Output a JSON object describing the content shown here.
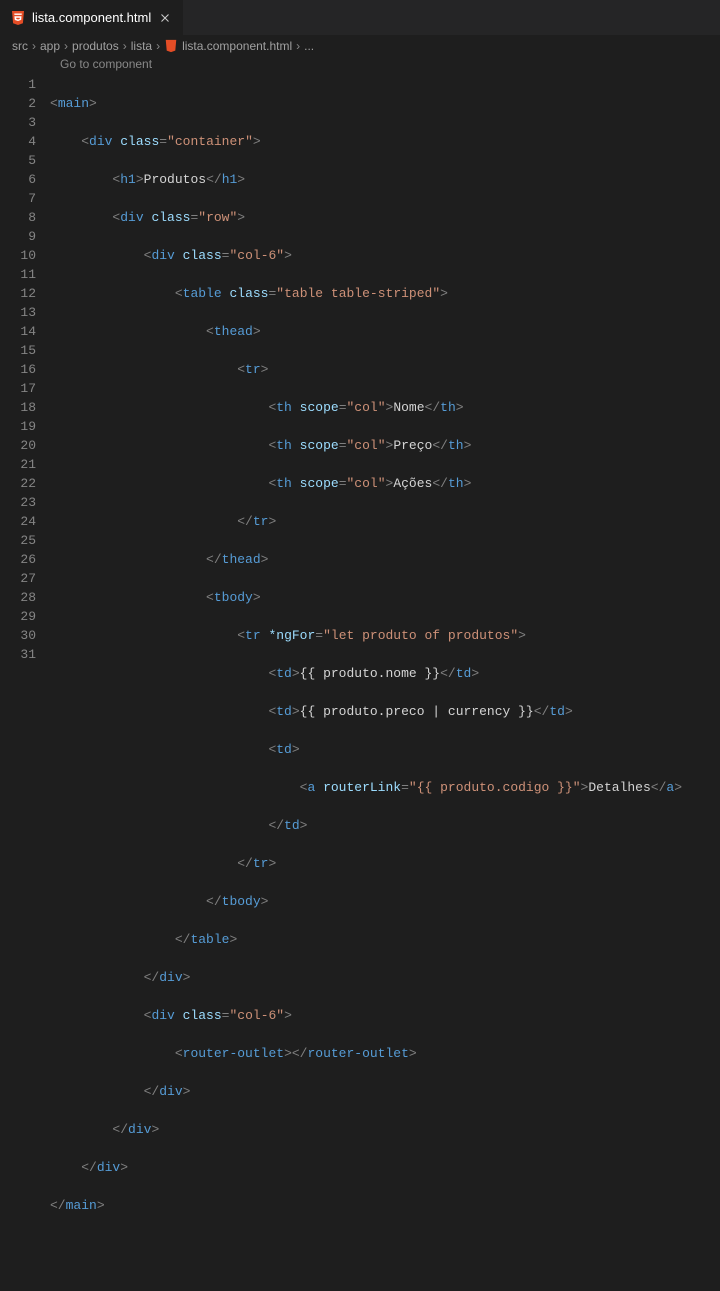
{
  "tab": {
    "title": "lista.component.html",
    "icon": "html5-icon"
  },
  "breadcrumbs": [
    "src",
    "app",
    "produtos",
    "lista",
    "lista.component.html",
    "..."
  ],
  "goToComponent": "Go to component",
  "lineNumbers": [
    "1",
    "2",
    "3",
    "4",
    "5",
    "6",
    "7",
    "8",
    "9",
    "10",
    "11",
    "12",
    "13",
    "14",
    "15",
    "16",
    "17",
    "18",
    "19",
    "20",
    "21",
    "22",
    "23",
    "24",
    "25",
    "26",
    "27",
    "28",
    "29",
    "30",
    "31"
  ],
  "code": {
    "line1": {
      "tag": "main"
    },
    "line2": {
      "tag": "div",
      "attr": "class",
      "val": "\"container\""
    },
    "line3": {
      "openTag": "h1",
      "text": "Produtos",
      "closeTag": "h1"
    },
    "line4": {
      "tag": "div",
      "attr": "class",
      "val": "\"row\""
    },
    "line5": {
      "tag": "div",
      "attr": "class",
      "val": "\"col-6\""
    },
    "line6": {
      "tag": "table",
      "attr": "class",
      "val": "\"table table-striped\""
    },
    "line7": {
      "tag": "thead"
    },
    "line8": {
      "tag": "tr"
    },
    "line9": {
      "tag": "th",
      "attr": "scope",
      "val": "\"col\"",
      "text": "Nome"
    },
    "line10": {
      "tag": "th",
      "attr": "scope",
      "val": "\"col\"",
      "text": "Preço"
    },
    "line11": {
      "tag": "th",
      "attr": "scope",
      "val": "\"col\"",
      "text": "Ações"
    },
    "line12": {
      "tag": "tr"
    },
    "line13": {
      "tag": "thead"
    },
    "line14": {
      "tag": "tbody"
    },
    "line15": {
      "tag": "tr",
      "attr": "*ngFor",
      "val": "\"let produto of produtos\""
    },
    "line16": {
      "tag": "td",
      "text": "{{ produto.nome }}"
    },
    "line17": {
      "tag": "td",
      "text": "{{ produto.preco | currency }}"
    },
    "line18": {
      "tag": "td"
    },
    "line19": {
      "tag": "a",
      "attr": "routerLink",
      "val": "\"{{ produto.codigo }}\"",
      "text": "Detalhes"
    },
    "line20": {
      "tag": "td"
    },
    "line21": {
      "tag": "tr"
    },
    "line22": {
      "tag": "tbody"
    },
    "line23": {
      "tag": "table"
    },
    "line24": {
      "tag": "div"
    },
    "line25": {
      "tag": "div",
      "attr": "class",
      "val": "\"col-6\""
    },
    "line26": {
      "open": "router-outlet",
      "close": "router-outlet"
    },
    "line27": {
      "tag": "div"
    },
    "line28": {
      "tag": "div"
    },
    "line29": {
      "tag": "div"
    },
    "line30": {
      "tag": "main"
    }
  }
}
